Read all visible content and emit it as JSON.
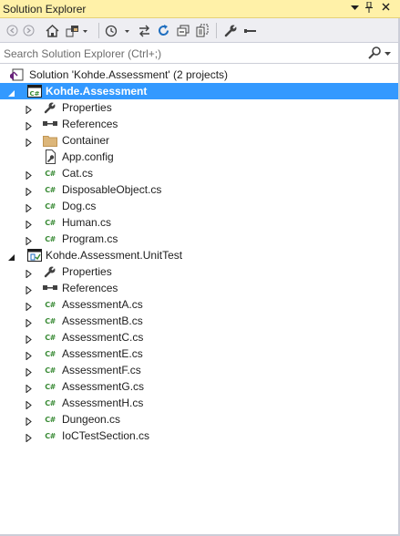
{
  "window": {
    "title": "Solution Explorer",
    "controls": [
      "dropdown-icon",
      "pin-icon",
      "close-icon"
    ]
  },
  "toolbar": {
    "buttons": [
      "back-icon",
      "forward-icon",
      "home-icon",
      "switch-views-icon",
      "pending-changes-filter-icon",
      "sync-with-active-document-icon",
      "refresh-icon",
      "collapse-all-icon",
      "show-all-files-icon",
      "properties-icon",
      "preview-icon"
    ]
  },
  "search": {
    "placeholder": "Search Solution Explorer (Ctrl+;)"
  },
  "tree": {
    "solution": {
      "label": "Solution 'Kohde.Assessment' (2 projects)"
    },
    "project1": {
      "label": "Kohde.Assessment",
      "items": [
        {
          "label": "Properties",
          "icon": "wrench-icon"
        },
        {
          "label": "References",
          "icon": "references-icon"
        },
        {
          "label": "Container",
          "icon": "folder-icon"
        },
        {
          "label": "App.config",
          "icon": "config-file-icon"
        },
        {
          "label": "Cat.cs",
          "icon": "csharp-file-icon"
        },
        {
          "label": "DisposableObject.cs",
          "icon": "csharp-file-icon"
        },
        {
          "label": "Dog.cs",
          "icon": "csharp-file-icon"
        },
        {
          "label": "Human.cs",
          "icon": "csharp-file-icon"
        },
        {
          "label": "Program.cs",
          "icon": "csharp-file-icon"
        }
      ]
    },
    "project2": {
      "label": "Kohde.Assessment.UnitTest",
      "items": [
        {
          "label": "Properties",
          "icon": "wrench-icon"
        },
        {
          "label": "References",
          "icon": "references-icon"
        },
        {
          "label": "AssessmentA.cs",
          "icon": "csharp-file-icon"
        },
        {
          "label": "AssessmentB.cs",
          "icon": "csharp-file-icon"
        },
        {
          "label": "AssessmentC.cs",
          "icon": "csharp-file-icon"
        },
        {
          "label": "AssessmentE.cs",
          "icon": "csharp-file-icon"
        },
        {
          "label": "AssessmentF.cs",
          "icon": "csharp-file-icon"
        },
        {
          "label": "AssessmentG.cs",
          "icon": "csharp-file-icon"
        },
        {
          "label": "AssessmentH.cs",
          "icon": "csharp-file-icon"
        },
        {
          "label": "Dungeon.cs",
          "icon": "csharp-file-icon"
        },
        {
          "label": "IoCTestSection.cs",
          "icon": "csharp-file-icon"
        }
      ]
    }
  },
  "colors": {
    "title_bar": "#fff1a8",
    "selection": "#3399ff",
    "csharp": "#388a34",
    "toolbar": "#eeeef2"
  }
}
